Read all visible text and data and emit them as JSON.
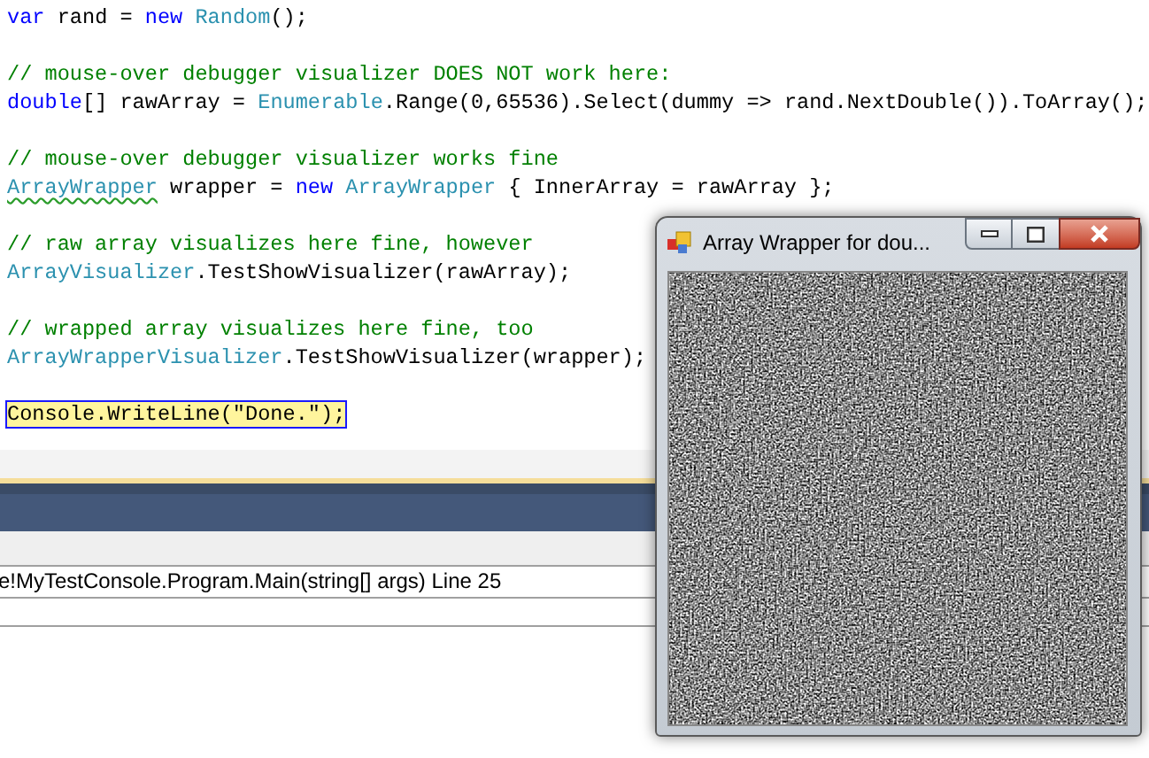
{
  "code_lines": [
    {
      "tokens": [
        {
          "kind": "keyword",
          "text": "var"
        },
        {
          "kind": "plain",
          "text": " rand = "
        },
        {
          "kind": "keyword",
          "text": "new"
        },
        {
          "kind": "type",
          "text": " Random"
        },
        {
          "kind": "plain",
          "text": "();"
        }
      ],
      "current": false
    },
    {
      "current": false
    },
    {
      "tokens": [
        {
          "kind": "comment",
          "text": "// mouse-over debugger visualizer DOES NOT work here:"
        }
      ],
      "current": false
    },
    {
      "tokens": [
        {
          "kind": "keyword",
          "text": "double"
        },
        {
          "kind": "plain",
          "text": "[] rawArray = "
        },
        {
          "kind": "type",
          "text": "Enumerable"
        },
        {
          "kind": "plain",
          "text": ".Range(0,65536).Select(dummy => rand.NextDouble()).ToArray();"
        }
      ],
      "current": false
    },
    {
      "current": false
    },
    {
      "tokens": [
        {
          "kind": "comment",
          "text": "// mouse-over debugger visualizer works fine"
        }
      ],
      "current": false
    },
    {
      "tokens": [
        {
          "kind": "type",
          "text": "ArrayWrapper",
          "squiggle": true
        },
        {
          "kind": "plain",
          "text": " wrapper = "
        },
        {
          "kind": "keyword",
          "text": "new"
        },
        {
          "kind": "type",
          "text": " ArrayWrapper"
        },
        {
          "kind": "plain",
          "text": " { InnerArray = rawArray };"
        }
      ],
      "current": false
    },
    {
      "current": false
    },
    {
      "tokens": [
        {
          "kind": "comment",
          "text": "// raw array visualizes here fine, however"
        }
      ],
      "current": false
    },
    {
      "tokens": [
        {
          "kind": "type",
          "text": "ArrayVisualizer"
        },
        {
          "kind": "plain",
          "text": ".TestShowVisualizer(rawArray);"
        }
      ],
      "current": false
    },
    {
      "current": false
    },
    {
      "tokens": [
        {
          "kind": "comment",
          "text": "// wrapped array visualizes here fine, too"
        }
      ],
      "current": false
    },
    {
      "tokens": [
        {
          "kind": "type",
          "text": "ArrayWrapperVisualizer"
        },
        {
          "kind": "plain",
          "text": ".TestShowVisualizer(wrapper);"
        }
      ],
      "current": false
    },
    {
      "current": false
    },
    {
      "tokens": [
        {
          "kind": "plain",
          "text": "Console"
        },
        {
          "kind": "plain",
          "text": ".WriteLine(\"Done.\");"
        }
      ],
      "current": true
    }
  ],
  "call_stack": {
    "rows": [
      "e!MyTestConsole.Program.Main(string[] args) Line 25"
    ]
  },
  "visualizer_window": {
    "title": "Array Wrapper for dou..."
  }
}
